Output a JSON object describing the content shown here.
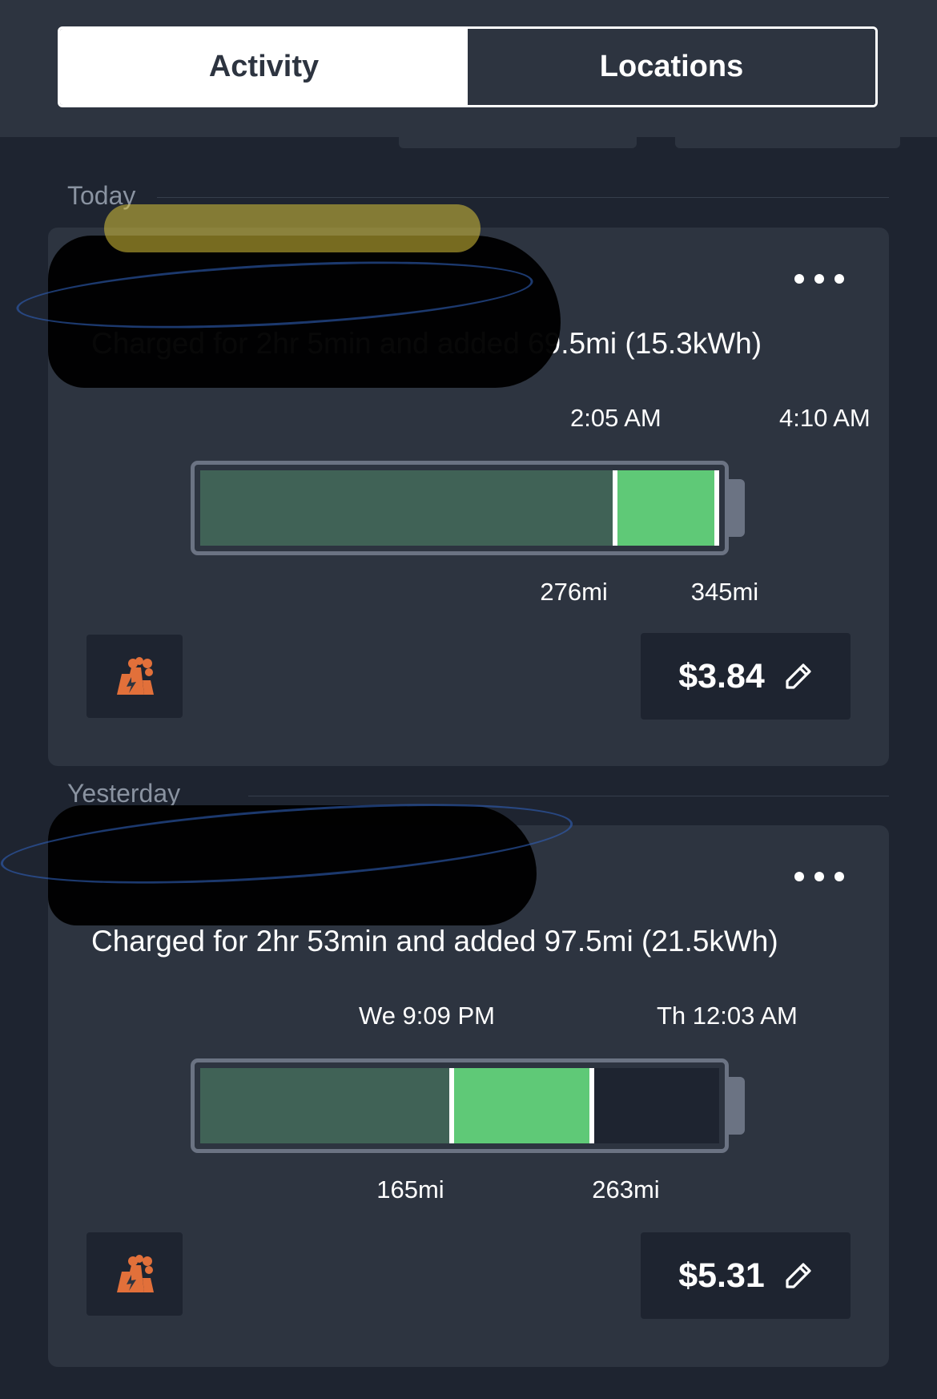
{
  "tabs": [
    {
      "label": "Activity",
      "active": true
    },
    {
      "label": "Locations",
      "active": false
    }
  ],
  "sessions": [
    {
      "section": "Today",
      "summary": "Charged for 2hr 5min and added 69.5mi (15.3kWh)",
      "start_time": "2:05 AM",
      "end_time": "4:10 AM",
      "start_range": "276mi",
      "end_range": "345mi",
      "start_level": 0.8,
      "end_level": 0.995,
      "cost": "$3.84",
      "source_icon": "power-plant-icon"
    },
    {
      "section": "Yesterday",
      "summary": "Charged for 2hr 53min and added 97.5mi (21.5kWh)",
      "start_time": "We 9:09 PM",
      "end_time": "Th 12:03 AM",
      "start_range": "165mi",
      "end_range": "263mi",
      "start_level": 0.485,
      "end_level": 0.755,
      "cost": "$5.31",
      "source_icon": "power-plant-icon"
    }
  ],
  "colors": {
    "background": "#1e2430",
    "card": "#2d3440",
    "battery_prev": "#406256",
    "battery_added": "#5fc977",
    "icon_orange": "#e2703a"
  }
}
